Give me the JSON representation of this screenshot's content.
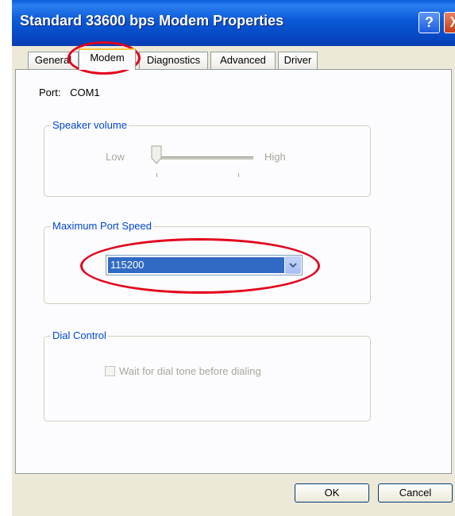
{
  "window": {
    "title": "Standard 33600 bps Modem Properties",
    "help_glyph": "?",
    "close_glyph": "X"
  },
  "tabs": [
    {
      "label": "General"
    },
    {
      "label": "Modem"
    },
    {
      "label": "Diagnostics"
    },
    {
      "label": "Advanced"
    },
    {
      "label": "Driver"
    }
  ],
  "active_tab": "Modem",
  "port": {
    "label": "Port:",
    "value": "COM1"
  },
  "speaker": {
    "group_label": "Speaker volume",
    "low_label": "Low",
    "high_label": "High",
    "level": 0.0
  },
  "speed": {
    "group_label": "Maximum Port Speed",
    "value": "115200"
  },
  "dial": {
    "group_label": "Dial Control",
    "checkbox_label": "Wait for dial tone before dialing",
    "checked": false
  },
  "buttons": {
    "ok": "OK",
    "cancel": "Cancel"
  },
  "colors": {
    "title_blue": "#0a5fd8",
    "group_label": "#0046d5",
    "selection": "#316ac5",
    "annotation": "#e3001b"
  }
}
